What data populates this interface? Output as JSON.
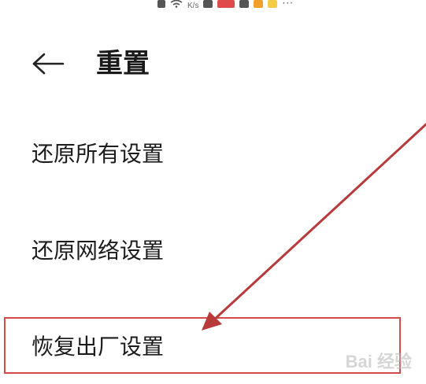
{
  "status_bar": {
    "net_speed_unit": "K/s",
    "icons": [
      "notification-icon",
      "wifi-icon",
      "app-icons",
      "more-icon"
    ]
  },
  "header": {
    "back_icon": "arrow-left-icon",
    "title": "重置"
  },
  "menu": {
    "items": [
      {
        "label": "还原所有设置"
      },
      {
        "label": "还原网络设置"
      },
      {
        "label": "恢复出厂设置"
      }
    ]
  },
  "annotation": {
    "highlight_color": "#d44a4a",
    "arrow_color": "#b83a3a"
  },
  "watermark": {
    "text": "Bai 经验"
  }
}
